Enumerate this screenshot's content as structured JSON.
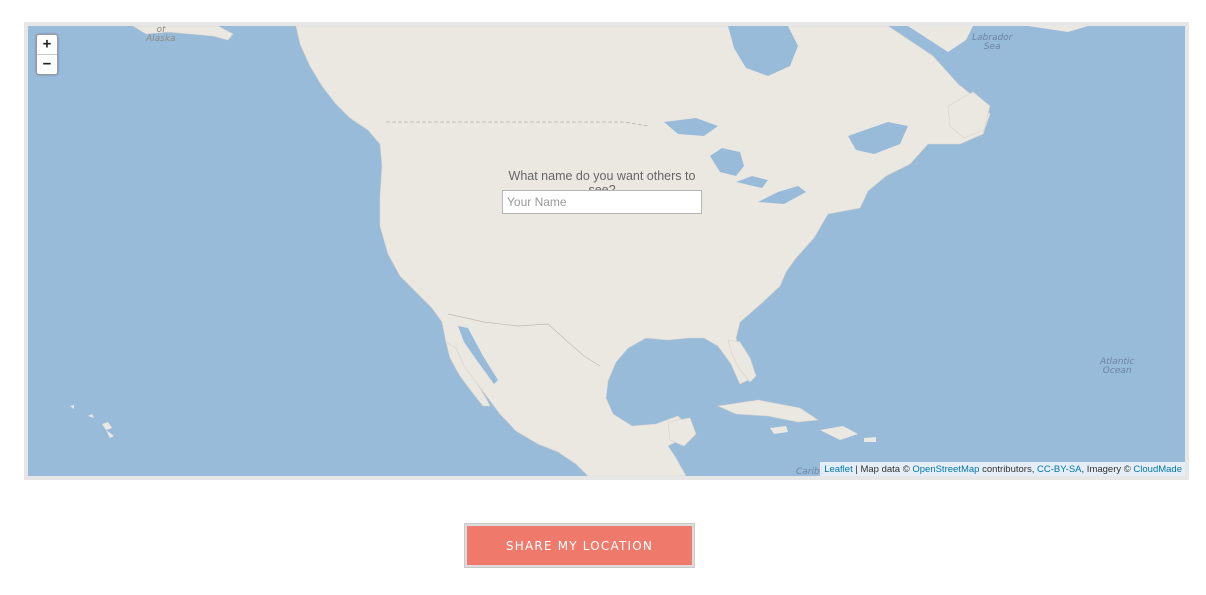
{
  "map": {
    "colors": {
      "water": "#99bbda",
      "land": "#ebe8e2",
      "border": "#c0b9b0"
    },
    "zoom": {
      "in_label": "+",
      "out_label": "−"
    },
    "labels": {
      "alaska_top": "of",
      "alaska": "Alaska",
      "labrador_1": "Labrador",
      "labrador_2": "Sea",
      "atlantic_1": "Atlantic",
      "atlantic_2": "Ocean",
      "caribbean": "Caribb"
    },
    "attribution": {
      "leaflet": "Leaflet",
      "sep": " | Map data © ",
      "osm": "OpenStreetMap",
      "contributors": " contributors, ",
      "license": "CC-BY-SA",
      "imagery": ", Imagery © ",
      "cloudmade": "CloudMade"
    }
  },
  "form": {
    "prompt": "What name do you want others to see?",
    "placeholder": "Your Name",
    "value": ""
  },
  "share_button": {
    "label": "SHARE MY LOCATION",
    "color": "#ef7a6b"
  }
}
